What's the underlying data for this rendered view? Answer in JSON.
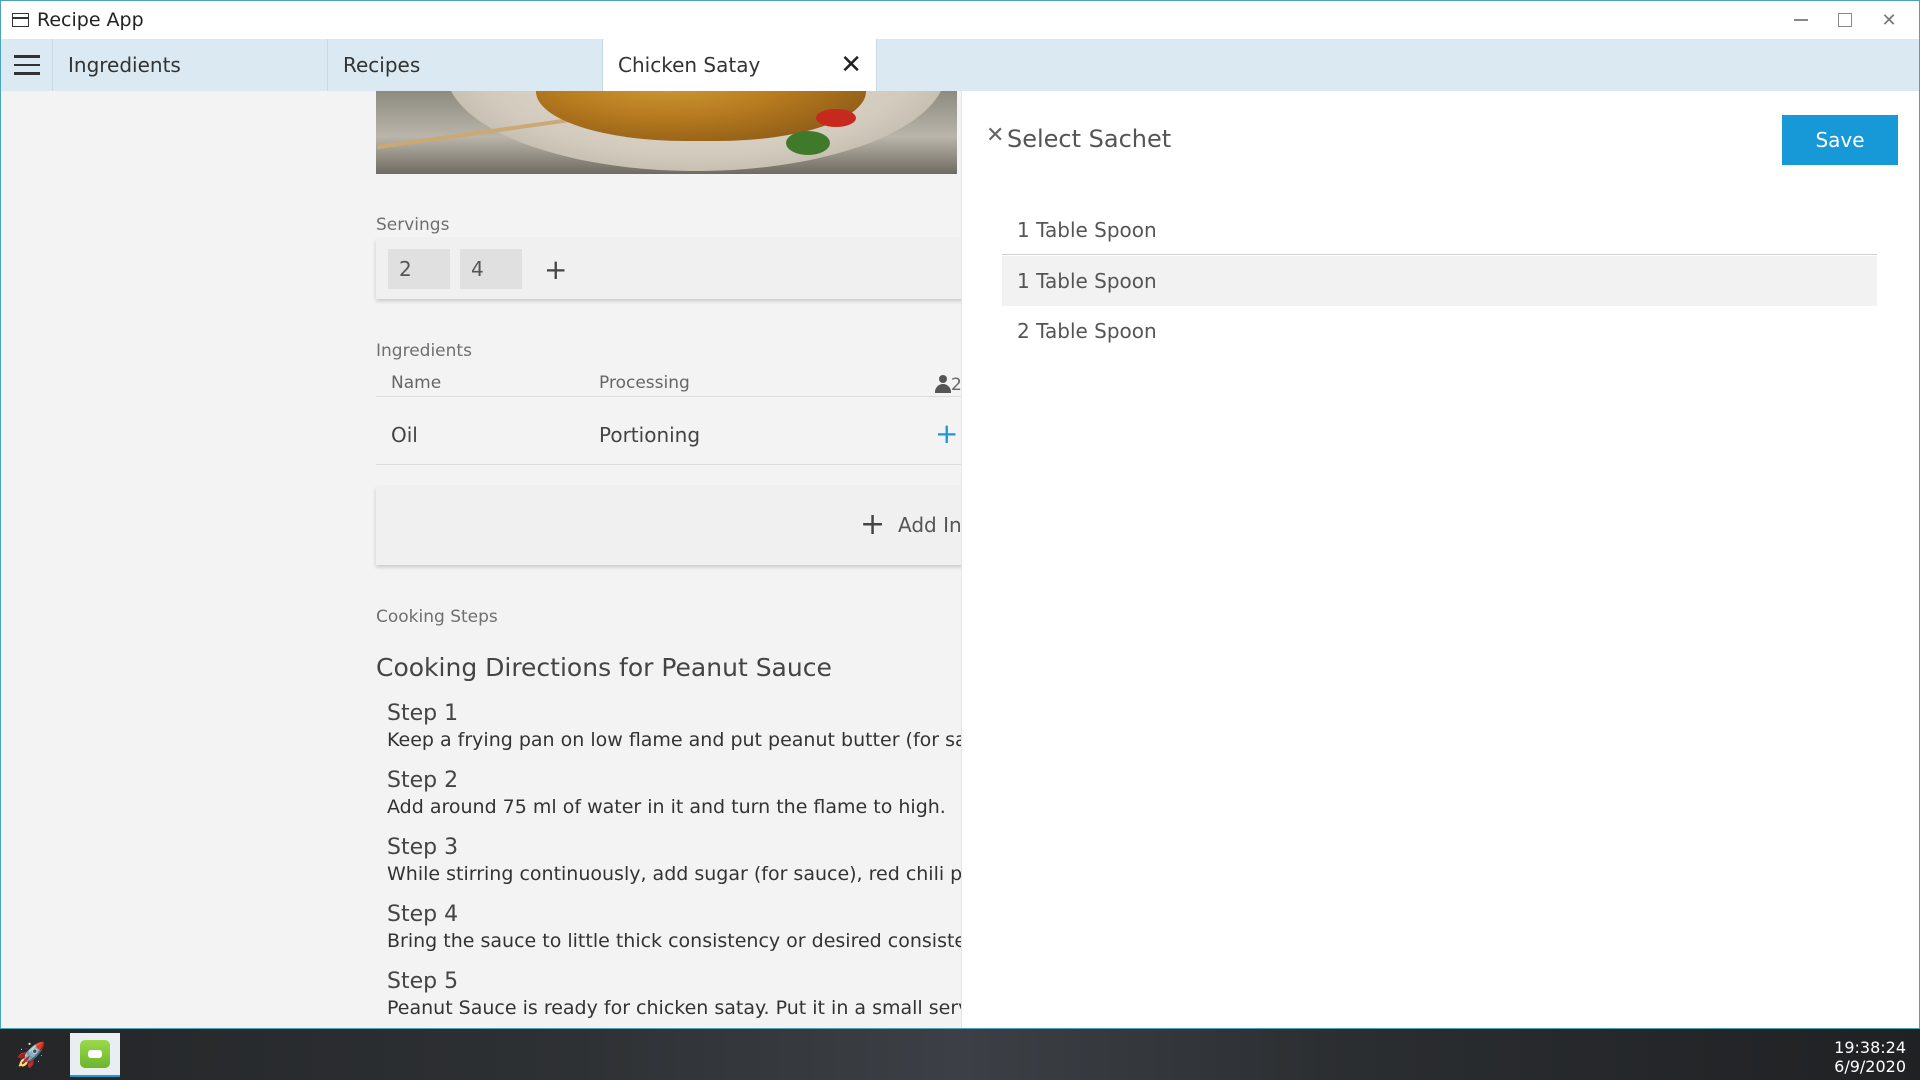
{
  "window": {
    "title": "Recipe App"
  },
  "tabs": [
    {
      "label": "Ingredients"
    },
    {
      "label": "Recipes"
    },
    {
      "label": "Chicken Satay"
    }
  ],
  "recipe": {
    "servings_label": "Servings",
    "servings": [
      "2",
      "4"
    ],
    "ingredients_label": "Ingredients",
    "ingredient_columns": {
      "name": "Name",
      "processing": "Processing",
      "persons": "2"
    },
    "ingredients": [
      {
        "name": "Oil",
        "processing": "Portioning"
      }
    ],
    "add_ingredient_label": "Add In",
    "cooking_steps_label": "Cooking Steps",
    "cooking_title": "Cooking Directions for Peanut Sauce",
    "steps": [
      {
        "title": "Step 1",
        "text": "Keep a frying pan on low flame and put peanut butter (for sau"
      },
      {
        "title": "Step 2",
        "text": "Add around 75 ml of water in it and turn the flame to high."
      },
      {
        "title": "Step 3",
        "text": "While stirring continuously, add sugar (for sauce), red chili po"
      },
      {
        "title": "Step 4",
        "text": "Bring the sauce to little thick consistency or desired consiste"
      },
      {
        "title": "Step 5",
        "text": "Peanut Sauce is ready for chicken satay. Put it in a small serv"
      }
    ]
  },
  "panel": {
    "title": "Select Sachet",
    "save_label": "Save",
    "options": [
      "1 Table Spoon",
      "1 Table Spoon",
      "2 Table Spoon"
    ]
  },
  "taskbar": {
    "time": "19:38:24",
    "date": "6/9/2020"
  },
  "colors": {
    "accent": "#1699d6",
    "tabbar": "#dbeaf2",
    "frame": "#4aa3b8"
  }
}
